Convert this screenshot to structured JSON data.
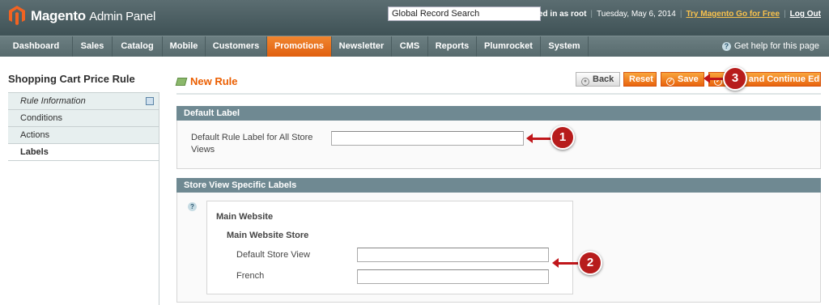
{
  "header": {
    "app_name": "Magento",
    "app_suffix": "Admin Panel",
    "search_value": "Global Record Search",
    "logged_in": "Logged in as root",
    "date": "Tuesday, May 6, 2014",
    "try_link": "Try Magento Go for Free",
    "logout": "Log Out"
  },
  "nav": {
    "items": [
      {
        "label": "Dashboard",
        "active": false
      },
      {
        "label": "Sales",
        "active": false
      },
      {
        "label": "Catalog",
        "active": false
      },
      {
        "label": "Mobile",
        "active": false
      },
      {
        "label": "Customers",
        "active": false
      },
      {
        "label": "Promotions",
        "active": true
      },
      {
        "label": "Newsletter",
        "active": false
      },
      {
        "label": "CMS",
        "active": false
      },
      {
        "label": "Reports",
        "active": false
      },
      {
        "label": "Plumrocket",
        "active": false
      },
      {
        "label": "System",
        "active": false
      }
    ],
    "help": "Get help for this page"
  },
  "sidebar": {
    "title": "Shopping Cart Price Rule",
    "tabs": [
      {
        "label": "Rule Information"
      },
      {
        "label": "Conditions"
      },
      {
        "label": "Actions"
      },
      {
        "label": "Labels"
      }
    ]
  },
  "main": {
    "title": "New Rule",
    "buttons": {
      "back": "Back",
      "reset": "Reset",
      "save": "Save",
      "save_continue": "Save and Continue Edit"
    },
    "default_label": {
      "heading": "Default Label",
      "field_label_line1": "Default Rule Label for All Store",
      "field_label_line2": "Views",
      "value": ""
    },
    "store_labels": {
      "heading": "Store View Specific Labels",
      "website": "Main Website",
      "store": "Main Website Store",
      "views": [
        {
          "label": "Default Store View",
          "value": ""
        },
        {
          "label": "French",
          "value": ""
        }
      ]
    }
  },
  "callouts": [
    "1",
    "2",
    "3"
  ],
  "colors": {
    "header_bg": "#4c5f63",
    "nav_active": "#eb6a16",
    "accent_orange": "#eb5e00",
    "section_head": "#6f8992",
    "callout_red": "#b71c1c"
  }
}
